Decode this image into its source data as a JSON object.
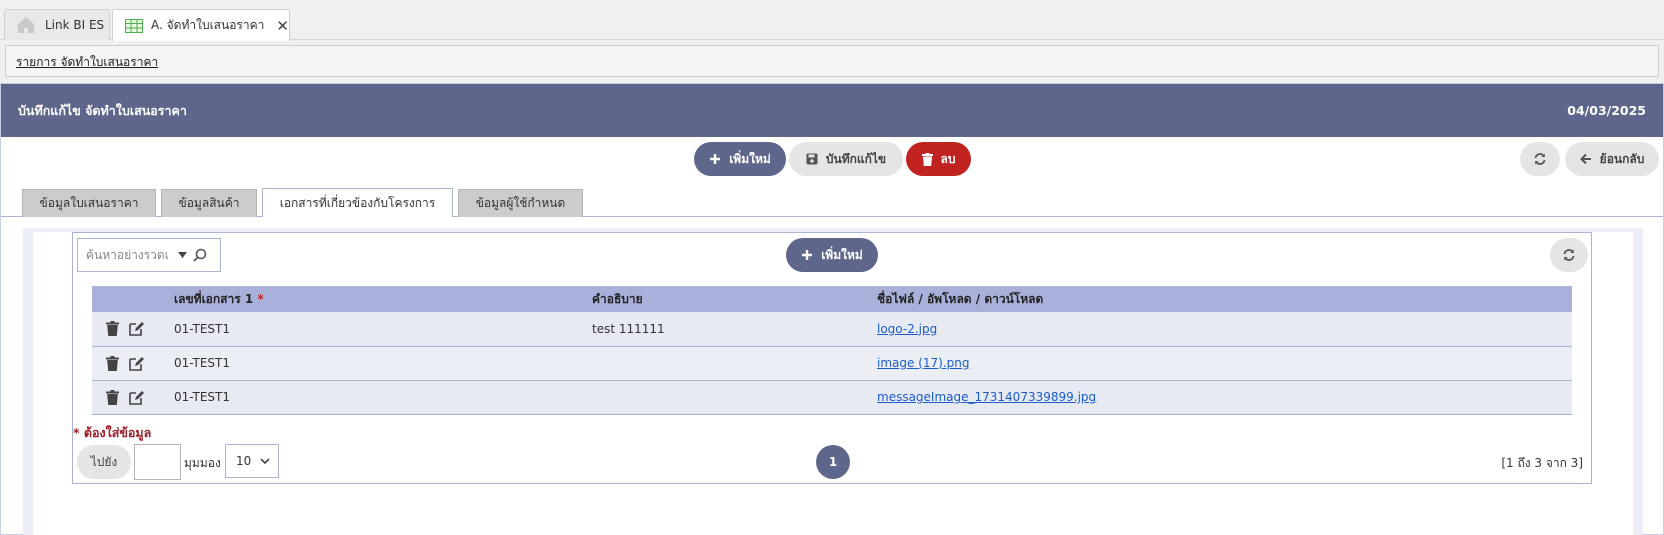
{
  "window_tabs": [
    {
      "label": "Link BI ES",
      "icon": "home-icon"
    },
    {
      "label": "A. จัดทำใบเสนอราคา",
      "icon": "table-grid-icon"
    }
  ],
  "breadcrumb": "รายการ จัดทำใบเสนอราคา",
  "panel": {
    "title": "บันทึกแก้ไข จัดทำใบเสนอราคา",
    "date": "04/03/2025"
  },
  "toolbar": {
    "add_label": "เพิ่มใหม่",
    "save_label": "บันทึกแก้ไข",
    "delete_label": "ลบ",
    "back_label": "ย้อนกลับ"
  },
  "inner_tabs": [
    {
      "label": "ข้อมูลใบเสนอราคา",
      "selected": false
    },
    {
      "label": "ข้อมูลสินค้า",
      "selected": false
    },
    {
      "label": "เอกสารที่เกี่ยวข้องกับโครงการ",
      "selected": true
    },
    {
      "label": "ข้อมูลผู้ใช้กำหนด",
      "selected": false
    }
  ],
  "grid": {
    "search_placeholder": "ค้นหาอย่างรวดเ",
    "add_label": "เพิ่มใหม่",
    "columns": {
      "doc_no": "เลขที่เอกสาร 1",
      "doc_no_required": "*",
      "description": "คำอธิบาย",
      "file": "ชื่อไฟล์ / อัพโหลด / ดาวน์โหลด"
    },
    "rows": [
      {
        "doc_no": "01-TEST1",
        "description": "test 111111",
        "file": "logo-2.jpg"
      },
      {
        "doc_no": "01-TEST1",
        "description": "",
        "file": "image (17).png"
      },
      {
        "doc_no": "01-TEST1",
        "description": "",
        "file": "messageImage_1731407339899.jpg"
      }
    ],
    "required_note": "* ต้องใส่ข้อมูล",
    "pager": {
      "goto_label": "ไปยัง",
      "goto_value": "",
      "view_label": "มุมมอง",
      "page_size": "10",
      "current_page": "1",
      "info": "[1 ถึง 3 จาก 3]"
    }
  },
  "colors": {
    "primary": "#5f668c",
    "danger": "#c0221f",
    "header_row": "#a9b1db",
    "link": "#1a5ccf"
  }
}
